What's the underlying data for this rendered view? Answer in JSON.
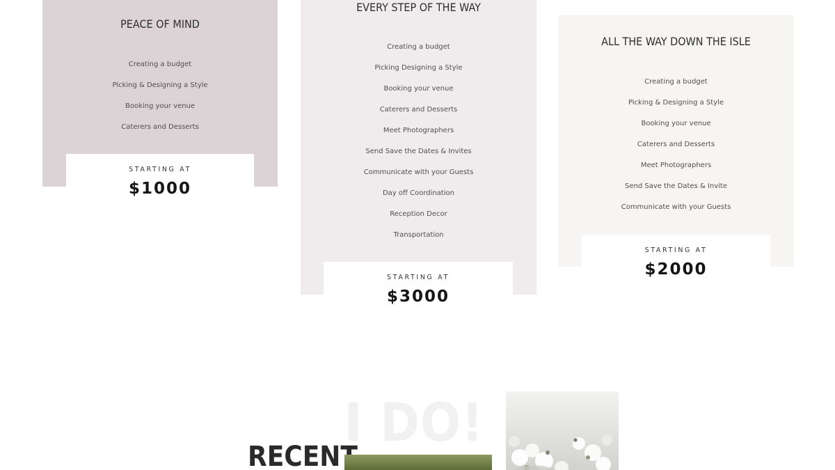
{
  "pricing": {
    "packages": [
      {
        "title": "PEACE OF MIND",
        "features": [
          "Creating a budget",
          "Picking & Designing a Style",
          "Booking your venue",
          "Caterers and Desserts"
        ],
        "starting_label": "STARTING AT",
        "price": "$1000"
      },
      {
        "title": "EVERY STEP OF THE WAY",
        "features": [
          "Creating a budget",
          "Picking Designing a Style",
          "Booking your venue",
          "Caterers and Desserts",
          "Meet Photographers",
          "Send Save the Dates & Invites",
          "Communicate with your Guests",
          "Day off Coordination",
          "Reception Decor",
          "Transportation"
        ],
        "starting_label": "STARTING AT",
        "price": "$3000"
      },
      {
        "title": "ALL THE WAY DOWN THE ISLE",
        "features": [
          "Creating a budget",
          "Picking & Designing a Style",
          "Booking your venue",
          "Caterers and Desserts",
          "Meet Photographers",
          "Send Save the Dates & Invite",
          "Communicate with your Guests"
        ],
        "starting_label": "STARTING AT",
        "price": "$2000"
      }
    ]
  },
  "recent": {
    "title": "RECENT",
    "overlay_text": "I DO!"
  },
  "colors": {
    "card1_bg": "#dcd3d7",
    "card2_bg": "#f0eced",
    "card3_bg": "#f7f4f4"
  }
}
